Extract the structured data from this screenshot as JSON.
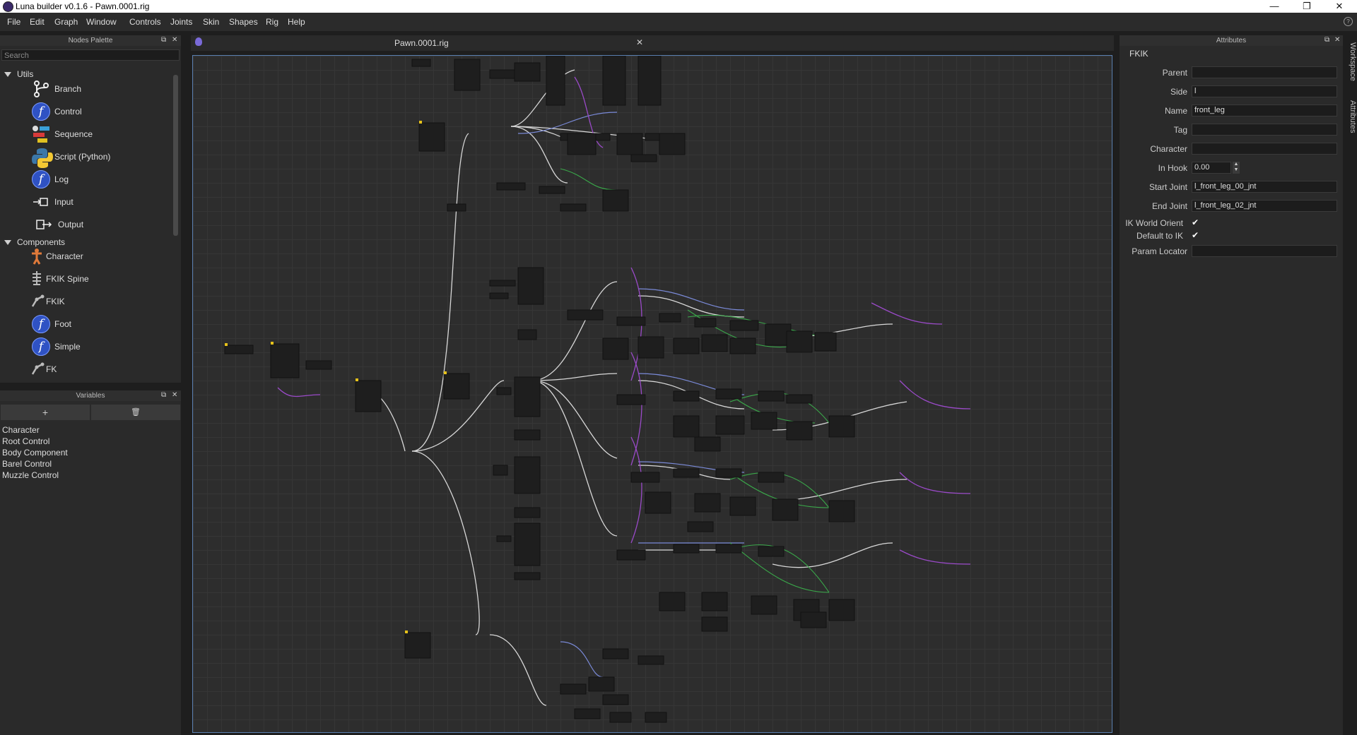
{
  "window": {
    "title": "Luna builder v0.1.6 - Pawn.0001.rig",
    "controls": {
      "minimize": "—",
      "restore": "❐",
      "close": "✕"
    }
  },
  "menu": [
    "File",
    "Edit",
    "Graph",
    "Window",
    "Controls",
    "Joints",
    "Skin",
    "Shapes",
    "Rig",
    "Help"
  ],
  "nodes_palette": {
    "title": "Nodes Palette",
    "search_placeholder": "Search",
    "categories": [
      {
        "label": "Utils",
        "items": [
          "Branch",
          "Control",
          "Sequence",
          "Script (Python)",
          "Log",
          "Input",
          "Output"
        ]
      },
      {
        "label": "Components",
        "items": [
          "Character",
          "FKIK Spine",
          "FKIK",
          "Foot",
          "Simple",
          "FK"
        ]
      }
    ]
  },
  "variables": {
    "title": "Variables",
    "add_label": "+",
    "delete_label": "🗑",
    "items": [
      "Character",
      "Root Control",
      "Body Component",
      "Barel Control",
      "Muzzle Control"
    ]
  },
  "graph": {
    "tab_title": "Pawn.0001.rig",
    "close_label": "✕"
  },
  "attributes": {
    "title": "Attributes",
    "node_type": "FKIK",
    "fields": {
      "parent": {
        "label": "Parent",
        "value": ""
      },
      "side": {
        "label": "Side",
        "value": "l"
      },
      "name": {
        "label": "Name",
        "value": "front_leg"
      },
      "tag": {
        "label": "Tag",
        "value": ""
      },
      "character": {
        "label": "Character",
        "value": ""
      },
      "in_hook": {
        "label": "In Hook",
        "value": "0.00"
      },
      "start_joint": {
        "label": "Start Joint",
        "value": "l_front_leg_00_jnt"
      },
      "end_joint": {
        "label": "End Joint",
        "value": "l_front_leg_02_jnt"
      },
      "ik_world_orient": {
        "label": "IK World Orient",
        "checked": true
      },
      "default_to_ik": {
        "label": "Default to IK",
        "checked": true
      },
      "param_locator": {
        "label": "Param Locator",
        "value": ""
      }
    },
    "side_tabs": [
      "Workspace",
      "Attributes"
    ]
  }
}
